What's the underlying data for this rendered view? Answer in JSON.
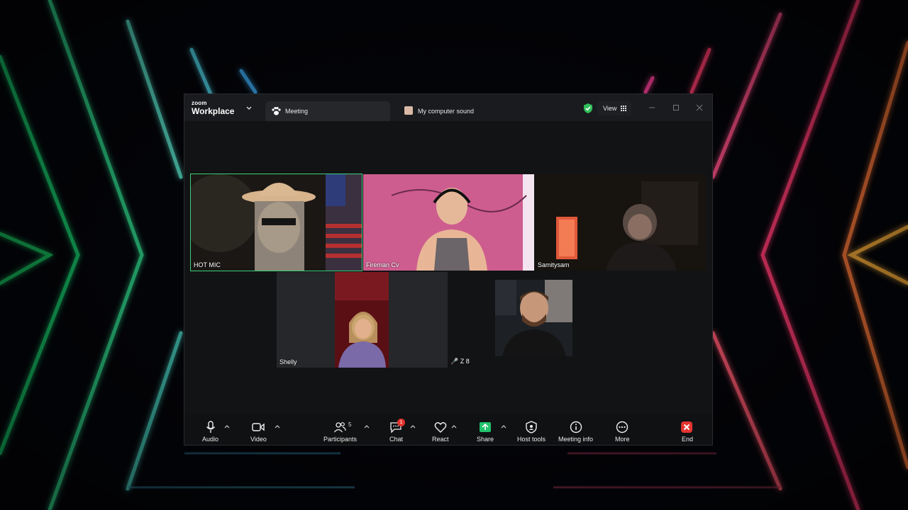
{
  "app": {
    "brand_small": "zoom",
    "brand_big": "Workplace",
    "tabs": [
      {
        "label": "Meeting",
        "icon": "paw-icon"
      },
      {
        "label": "My computer sound",
        "icon": "sound-icon"
      }
    ],
    "view_label": "View"
  },
  "participants": [
    {
      "name": "HOT MIC",
      "active": true
    },
    {
      "name": "Fireman Cv"
    },
    {
      "name": "Samitysam"
    },
    {
      "name": "Shelly"
    },
    {
      "name": "Z 8",
      "muted": true
    },
    {
      "name": ""
    }
  ],
  "toolbar": {
    "audio": "Audio",
    "video": "Video",
    "participants": "Participants",
    "participants_count": "5",
    "chat": "Chat",
    "chat_badge": "1",
    "react": "React",
    "share": "Share",
    "host_tools": "Host tools",
    "meeting_info": "Meeting info",
    "more": "More",
    "end": "End"
  },
  "colors": {
    "active_speaker": "#3ad07a",
    "share_green": "#21c26b",
    "end_red": "#e5342f"
  }
}
